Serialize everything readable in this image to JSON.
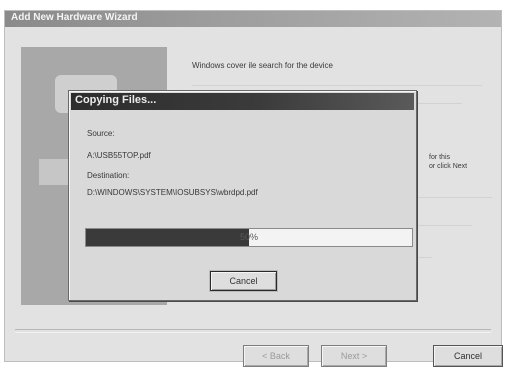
{
  "wizard": {
    "title": "Add New Hardware Wizard",
    "message": "Windows cover ile search for the device",
    "side_message_line1": "for this",
    "side_message_line2": "or click Next",
    "back_label": "< Back",
    "next_label": "Next >",
    "cancel_label": "Cancel"
  },
  "copy_dialog": {
    "title": "Copying Files...",
    "source_label": "Source:",
    "source_value": "A:\\USB55TOP.pdf",
    "destination_label": "Destination:",
    "destination_value": "D:\\WINDOWS\\SYSTEM\\IOSUBSYS\\wbrdpd.pdf",
    "progress_text": "50%",
    "progress_fraction": 0.5,
    "cancel_label": "Cancel"
  }
}
